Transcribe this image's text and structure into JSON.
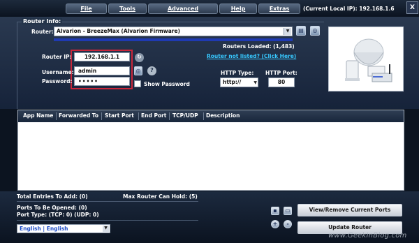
{
  "menubar": {
    "file": "File",
    "tools": "Tools",
    "advanced": "Advanced",
    "help": "Help",
    "extras": "Extras",
    "current_ip": "(Current Local IP): 192.168.1.6",
    "close": "X"
  },
  "router_info": {
    "legend": "Router Info:",
    "router_label": "Router:",
    "router_value": "Alvarion - BreezeMax (Alvarion Firmware)",
    "routers_loaded": "Routers Loaded: (1,483)",
    "not_listed_link": "Router not listed? (Click Here)",
    "ip_label": "Router IP:",
    "ip_value": "192.168.1.1",
    "username_label": "Username:",
    "username_value": "admin",
    "password_label": "Password:",
    "password_value": "•••••",
    "show_password": "Show Password",
    "help_symbol": "?",
    "http_type_label": "HTTP Type:",
    "http_type_value": "http://",
    "http_port_label": "HTTP Port:",
    "http_port_value": "80"
  },
  "table": {
    "columns": [
      "App Name",
      "Forwarded To",
      "Start Port",
      "End Port",
      "TCP/UDP",
      "Description"
    ]
  },
  "bottom": {
    "total_entries": "Total Entries To Add: (0)",
    "max_router": "Max Router Can Hold: (5)",
    "ports_open": "Ports To Be Opened: (0)",
    "port_type": "Port Type: (TCP: 0) (UDP: 0)",
    "language": "English | English",
    "view_remove": "View/Remove Current Ports",
    "update_router": "Update Router",
    "plus": "+",
    "minus": "-"
  },
  "watermark": "www.GeekInBlog.com",
  "colors": {
    "accent_link": "#37c8ff",
    "highlight": "#c8263a",
    "progress": "#1f3ab2"
  }
}
